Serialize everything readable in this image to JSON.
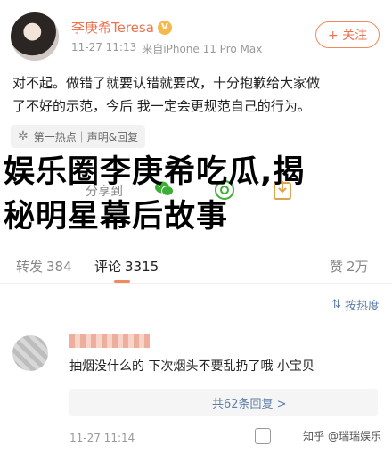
{
  "header": {
    "name": "李庚希Teresa",
    "meta_time": "11-27 11:13",
    "meta_source": "来自iPhone 11 Pro Max",
    "follow_label": "+ 关注"
  },
  "post": {
    "line1": "对不起。做错了就要认错就要改，十分抱歉给大家做",
    "line2": "了不好的示范，今后 我一定会更规范自己的行为。"
  },
  "hot_tag": {
    "text": "第一热点｜声明&回复"
  },
  "share": {
    "label": "分享到"
  },
  "overlay": {
    "line1": "娱乐圈李庚希吃瓜,揭",
    "line2": "秘明星幕后故事"
  },
  "tabs": [
    {
      "label": "转发",
      "count": "384"
    },
    {
      "label": "评论",
      "count": "3315"
    },
    {
      "label": "赞",
      "count": "2万"
    }
  ],
  "sort": {
    "label": "按热度"
  },
  "comment": {
    "text": "抽烟没什么的 下次烟头不要乱扔了哦 小宝贝",
    "reply_link": "共62条回复 >",
    "time": "11-27 11:14",
    "watermark": "知乎 @瑞瑞娱乐"
  }
}
